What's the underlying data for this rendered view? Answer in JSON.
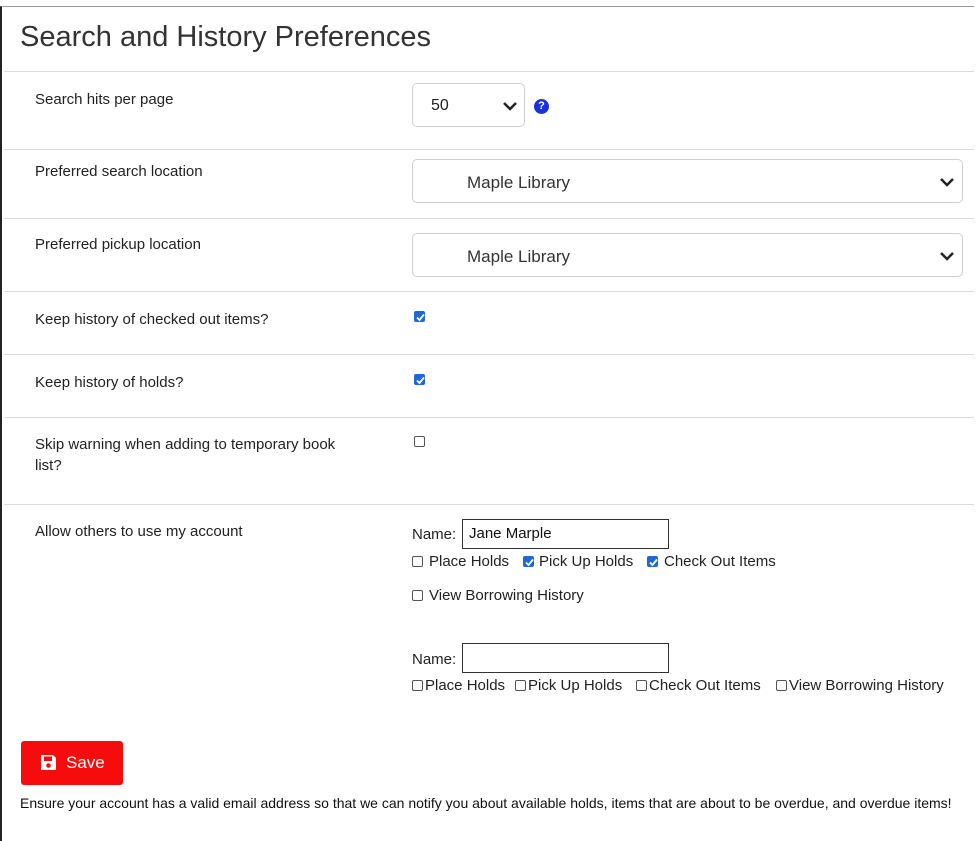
{
  "page": {
    "title": "Search and History Preferences"
  },
  "prefs": {
    "hits_label": "Search hits per page",
    "hits_value": "50",
    "help_glyph": "?",
    "search_location_label": "Preferred search location",
    "search_location_value": "Maple Library",
    "pickup_location_label": "Preferred pickup location",
    "pickup_location_value": "Maple Library",
    "keep_checkout_label": "Keep history of checked out items?",
    "keep_checkout_checked": true,
    "keep_holds_label": "Keep history of holds?",
    "keep_holds_checked": true,
    "skip_warning_label_1": "Skip warning when adding to temporary book",
    "skip_warning_label_2": "list?",
    "skip_warning_checked": false,
    "allow_others_label": "Allow others to use my account"
  },
  "proxies": [
    {
      "name_label": "Name:",
      "name_value": "Jane Marple",
      "place_holds": "Place Holds",
      "place_holds_checked": false,
      "pick_up_holds": "Pick Up Holds",
      "pick_up_holds_checked": true,
      "check_out_items": "Check Out Items",
      "check_out_items_checked": true,
      "view_history": "View Borrowing History",
      "view_history_checked": false
    },
    {
      "name_label": "Name:",
      "name_value": "",
      "place_holds": "Place Holds",
      "place_holds_checked": false,
      "pick_up_holds": "Pick Up Holds",
      "pick_up_holds_checked": false,
      "check_out_items": "Check Out Items",
      "check_out_items_checked": false,
      "view_history": "View Borrowing History",
      "view_history_checked": false
    }
  ],
  "actions": {
    "save_label": "Save"
  },
  "footer": {
    "note": "Ensure your account has a valid email address so that we can notify you about available holds, items that are about to be overdue, and overdue items!"
  },
  "colors": {
    "accent": "#1e68d8",
    "save": "#f60c0c",
    "help": "#1a2fe0"
  },
  "icons": {
    "help": "question-circle-icon",
    "save": "floppy-disk-icon",
    "dropdown": "chevron-down-icon",
    "check": "checkmark-icon"
  }
}
